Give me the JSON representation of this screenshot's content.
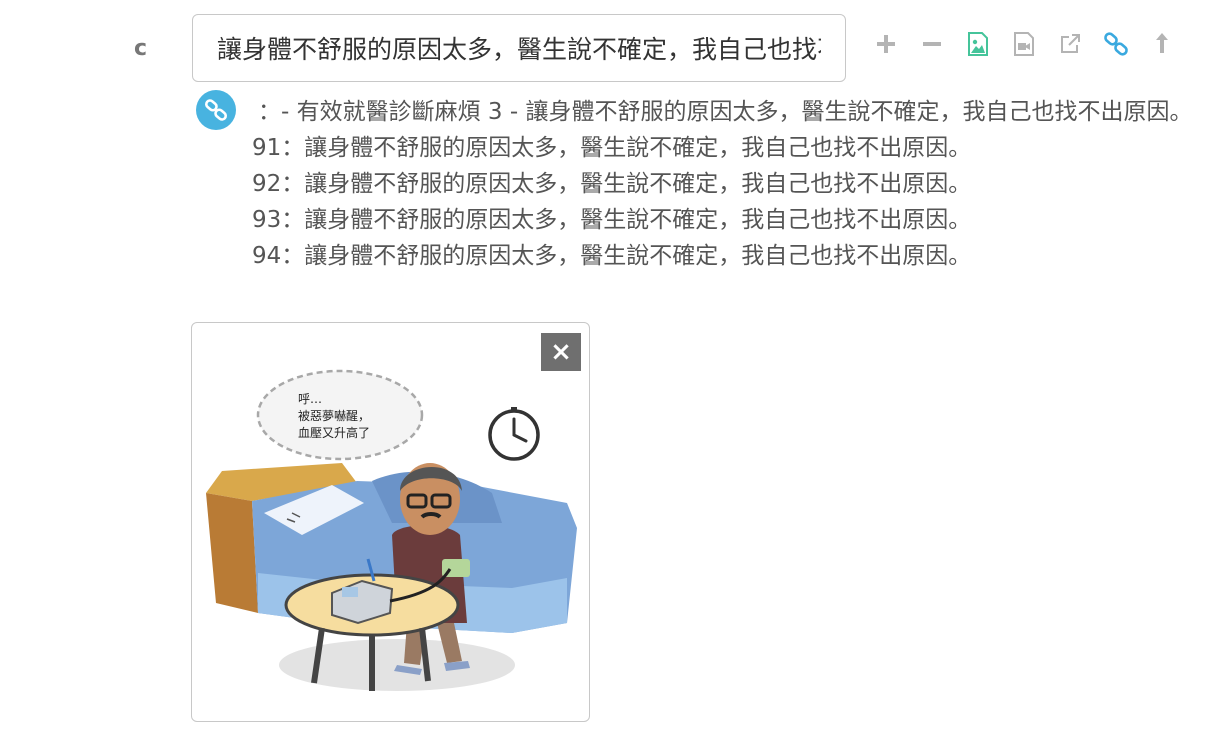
{
  "row": {
    "label": "c"
  },
  "input": {
    "value": "讓身體不舒服的原因太多，醫生說不確定，我自己也找不出原因。"
  },
  "toolbar": {
    "buttons": [
      {
        "icon": "plus-icon"
      },
      {
        "icon": "minus-icon"
      },
      {
        "icon": "image-icon"
      },
      {
        "icon": "video-file-icon"
      },
      {
        "icon": "external-link-icon"
      },
      {
        "icon": "link-icon"
      },
      {
        "icon": "upload-arrow-icon"
      }
    ],
    "colors": {
      "gray": "#b4b4b4",
      "green": "#45c49a",
      "blue": "#3aa9df"
    }
  },
  "content": {
    "header": "：- 有效就醫診斷麻煩 3 - 讓身體不舒服的原因太多，醫生說不確定，我自己也找不出原因。",
    "lines": [
      "91：讓身體不舒服的原因太多，醫生說不確定，我自己也找不出原因。",
      "92：讓身體不舒服的原因太多，醫生說不確定，我自己也找不出原因。",
      "93：讓身體不舒服的原因太多，醫生說不確定，我自己也找不出原因。",
      "94：讓身體不舒服的原因太多，醫生說不確定，我自己也找不出原因。"
    ]
  },
  "illustration": {
    "bubble_lines": [
      "呼…",
      "被惡夢嚇醒，",
      "血壓又升高了"
    ],
    "close_label": "×"
  }
}
